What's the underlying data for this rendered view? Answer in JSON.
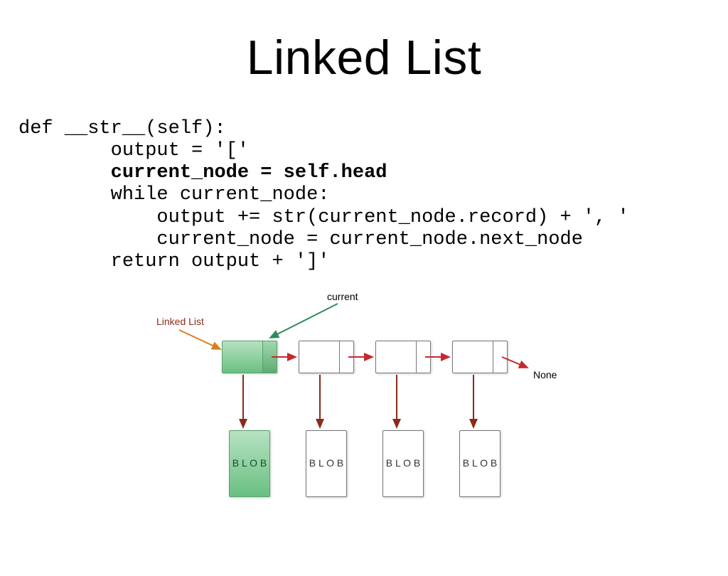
{
  "title": "Linked List",
  "code": {
    "line1": "def __str__(self):",
    "line2": "        output = '['",
    "line3": "        current_node = self.head",
    "line4": "        while current_node:",
    "line5": "            output += str(current_node.record) + ', '",
    "line6": "            current_node = current_node.next_node",
    "line7": "        return output + ']'"
  },
  "diagram": {
    "linked_list_label": "Linked List",
    "current_label": "current",
    "none_label": "None",
    "blob_text": "B\nL\nO\nB"
  }
}
